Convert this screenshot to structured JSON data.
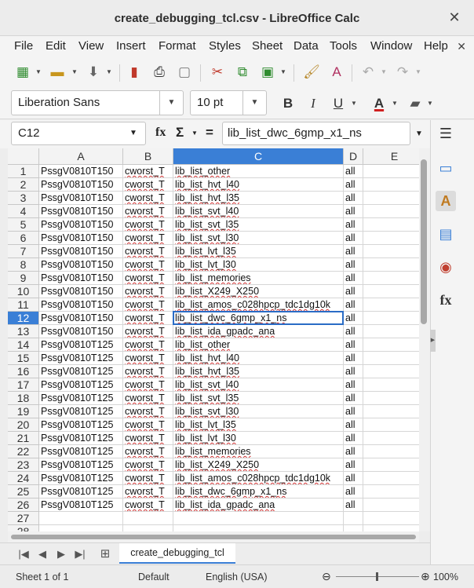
{
  "window": {
    "title": "create_debugging_tcl.csv - LibreOffice Calc",
    "close_glyph": "✕"
  },
  "menu": [
    "File",
    "Edit",
    "View",
    "Insert",
    "Format",
    "Styles",
    "Sheet",
    "Data",
    "Tools",
    "Window",
    "Help"
  ],
  "menu_close_glyph": "✕",
  "font": {
    "name": "Liberation Sans",
    "size": "10 pt"
  },
  "formula_bar": {
    "cell_ref": "C12",
    "fx": "fx",
    "sigma": "Σ",
    "equals": "=",
    "content": "lib_list_dwc_6gmp_x1_ns"
  },
  "columns": [
    "A",
    "B",
    "C",
    "D",
    "E"
  ],
  "selected_column": "C",
  "active_row": 12,
  "rows": [
    {
      "n": "1",
      "a": "PssgV0810T150",
      "b": "cworst_T",
      "c": "lib_list_other",
      "d": "all"
    },
    {
      "n": "2",
      "a": "PssgV0810T150",
      "b": "cworst_T",
      "c": "lib_list_hvt_l40",
      "d": "all"
    },
    {
      "n": "3",
      "a": "PssgV0810T150",
      "b": "cworst_T",
      "c": "lib_list_hvt_l35",
      "d": "all"
    },
    {
      "n": "4",
      "a": "PssgV0810T150",
      "b": "cworst_T",
      "c": "lib_list_svt_l40",
      "d": "all"
    },
    {
      "n": "5",
      "a": "PssgV0810T150",
      "b": "cworst_T",
      "c": "lib_list_svt_l35",
      "d": "all"
    },
    {
      "n": "6",
      "a": "PssgV0810T150",
      "b": "cworst_T",
      "c": "lib_list_svt_l30",
      "d": "all"
    },
    {
      "n": "7",
      "a": "PssgV0810T150",
      "b": "cworst_T",
      "c": "lib_list_lvt_l35",
      "d": "all"
    },
    {
      "n": "8",
      "a": "PssgV0810T150",
      "b": "cworst_T",
      "c": "lib_list_lvt_l30",
      "d": "all"
    },
    {
      "n": "9",
      "a": "PssgV0810T150",
      "b": "cworst_T",
      "c": "lib_list_memories",
      "d": "all"
    },
    {
      "n": "10",
      "a": "PssgV0810T150",
      "b": "cworst_T",
      "c": "lib_list_X249_X250",
      "d": "all"
    },
    {
      "n": "11",
      "a": "PssgV0810T150",
      "b": "cworst_T",
      "c": "lib_list_amos_c028hpcp_tdc1dg10k",
      "d": "all"
    },
    {
      "n": "12",
      "a": "PssgV0810T150",
      "b": "cworst_T",
      "c": "lib_list_dwc_6gmp_x1_ns",
      "d": "all"
    },
    {
      "n": "13",
      "a": "PssgV0810T150",
      "b": "cworst_T",
      "c": "lib_list_ida_gpadc_ana",
      "d": "all"
    },
    {
      "n": "14",
      "a": "PssgV0810T125",
      "b": "cworst_T",
      "c": "lib_list_other",
      "d": "all"
    },
    {
      "n": "15",
      "a": "PssgV0810T125",
      "b": "cworst_T",
      "c": "lib_list_hvt_l40",
      "d": "all"
    },
    {
      "n": "16",
      "a": "PssgV0810T125",
      "b": "cworst_T",
      "c": "lib_list_hvt_l35",
      "d": "all"
    },
    {
      "n": "17",
      "a": "PssgV0810T125",
      "b": "cworst_T",
      "c": "lib_list_svt_l40",
      "d": "all"
    },
    {
      "n": "18",
      "a": "PssgV0810T125",
      "b": "cworst_T",
      "c": "lib_list_svt_l35",
      "d": "all"
    },
    {
      "n": "19",
      "a": "PssgV0810T125",
      "b": "cworst_T",
      "c": "lib_list_svt_l30",
      "d": "all"
    },
    {
      "n": "20",
      "a": "PssgV0810T125",
      "b": "cworst_T",
      "c": "lib_list_lvt_l35",
      "d": "all"
    },
    {
      "n": "21",
      "a": "PssgV0810T125",
      "b": "cworst_T",
      "c": "lib_list_lvt_l30",
      "d": "all"
    },
    {
      "n": "22",
      "a": "PssgV0810T125",
      "b": "cworst_T",
      "c": "lib_list_memories",
      "d": "all"
    },
    {
      "n": "23",
      "a": "PssgV0810T125",
      "b": "cworst_T",
      "c": "lib_list_X249_X250",
      "d": "all"
    },
    {
      "n": "24",
      "a": "PssgV0810T125",
      "b": "cworst_T",
      "c": "lib_list_amos_c028hpcp_tdc1dg10k",
      "d": "all"
    },
    {
      "n": "25",
      "a": "PssgV0810T125",
      "b": "cworst_T",
      "c": "lib_list_dwc_6gmp_x1_ns",
      "d": "all"
    },
    {
      "n": "26",
      "a": "PssgV0810T125",
      "b": "cworst_T",
      "c": "lib_list_ida_gpadc_ana",
      "d": "all"
    },
    {
      "n": "27",
      "a": "",
      "b": "",
      "c": "",
      "d": ""
    },
    {
      "n": "28",
      "a": "",
      "b": "",
      "c": "",
      "d": ""
    }
  ],
  "sheet_tab": "create_debugging_tcl",
  "status": {
    "sheet": "Sheet 1 of 1",
    "style": "Default",
    "language": "English (USA)",
    "zoom": "100%",
    "zoom_minus": "⊖",
    "zoom_plus": "⊕"
  },
  "colors": {
    "accent": "#3a7fd6",
    "spell": "#d03030"
  }
}
